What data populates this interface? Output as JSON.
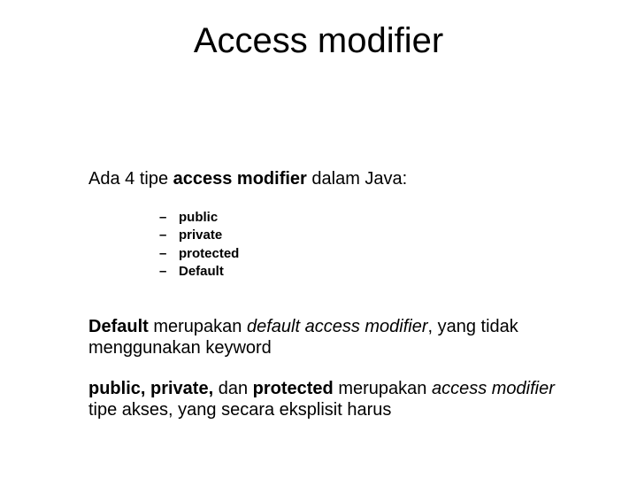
{
  "title": "Access modifier",
  "intro": {
    "pre": "Ada 4 tipe ",
    "bold": "access modifier",
    "post": " dalam Java:"
  },
  "dash": "–",
  "items": [
    "public",
    "private",
    "protected",
    "Default"
  ],
  "para1": {
    "t1": "Default",
    "t2": " merupakan ",
    "t3": "default access modifier",
    "t4": ", yang tidak menggunakan keyword"
  },
  "para2": {
    "t1": "public, private, ",
    "t2": "dan",
    "t3": " protected ",
    "t4": "merupakan ",
    "t5": "access modifier",
    "t6": " tipe akses, yang secara eksplisit harus"
  }
}
